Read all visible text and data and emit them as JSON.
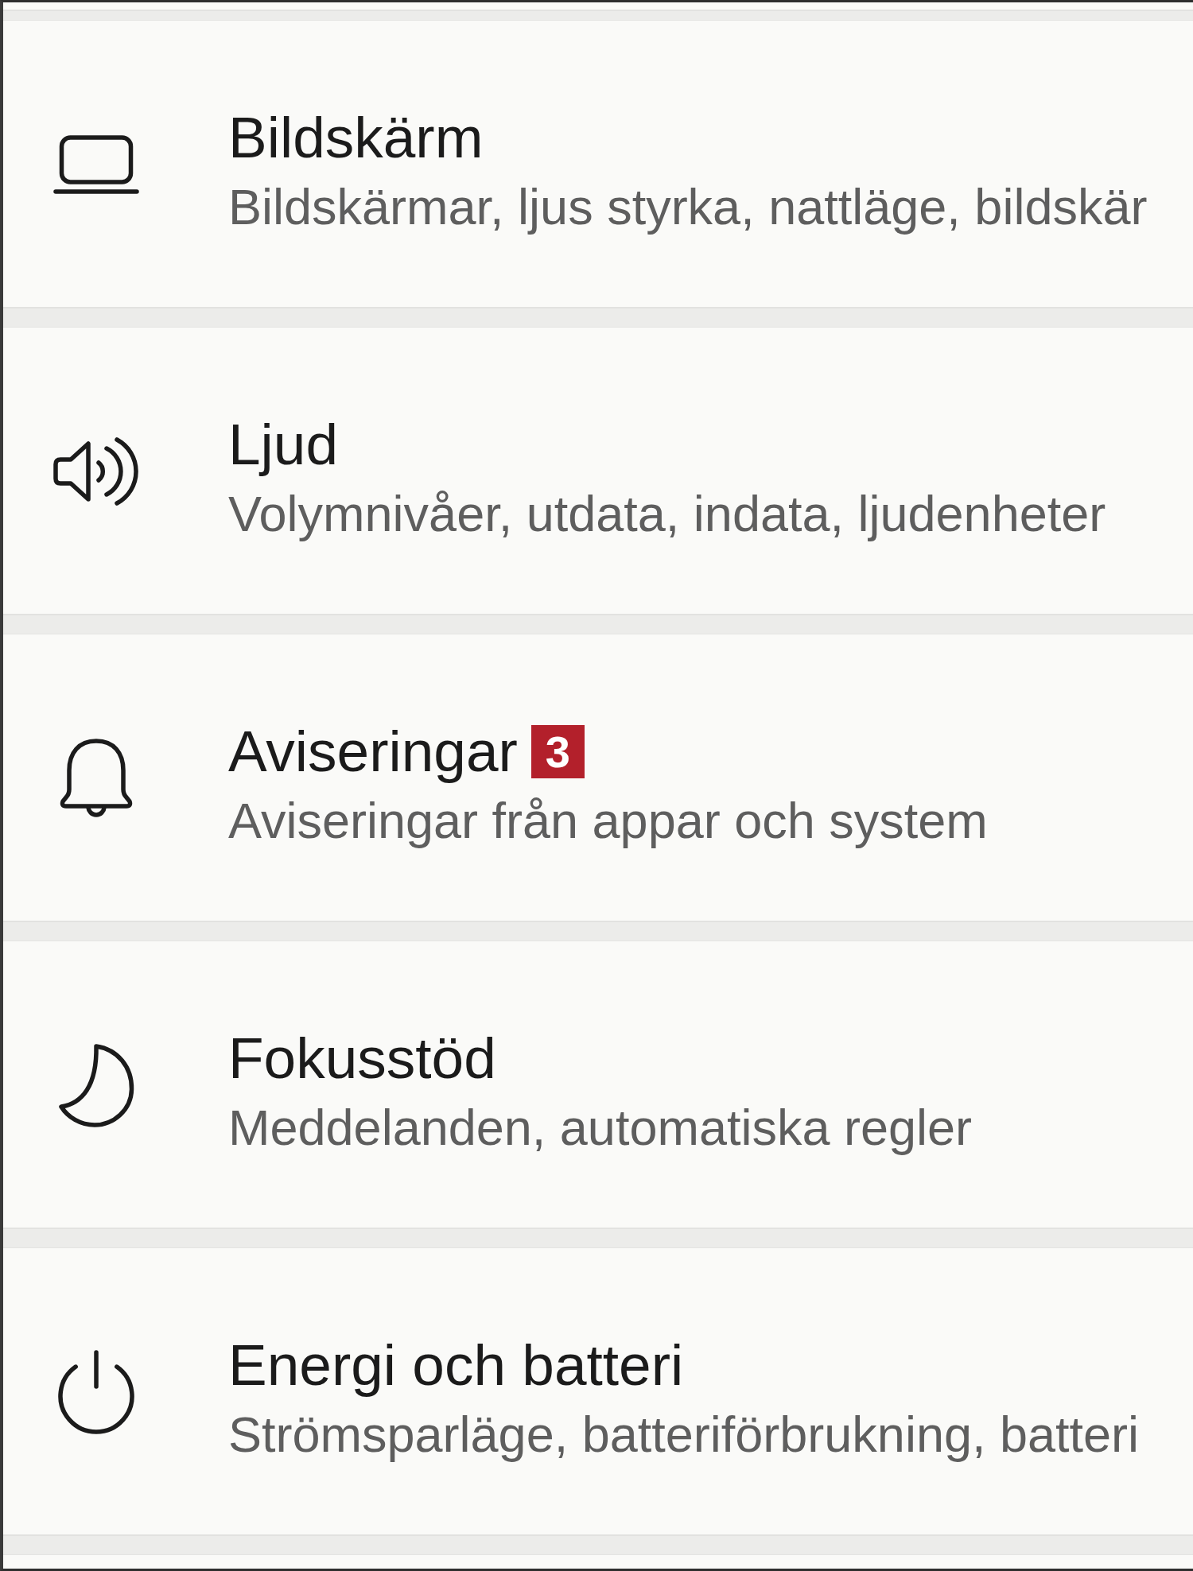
{
  "settings_list": {
    "items": [
      {
        "title": "Bildskärm",
        "subtitle": "Bildskärmar, ljus styrka, nattläge, bildskär"
      },
      {
        "title": "Ljud",
        "subtitle": "Volymnivåer, utdata, indata, ljudenheter"
      },
      {
        "title": "Aviseringar",
        "badge": "3",
        "subtitle": "Aviseringar från appar och system"
      },
      {
        "title": "Fokusstöd",
        "subtitle": "Meddelanden, automatiska regler"
      },
      {
        "title": "Energi och batteri",
        "subtitle": "Strömsparläge, batteriförbrukning, batteri"
      }
    ]
  }
}
